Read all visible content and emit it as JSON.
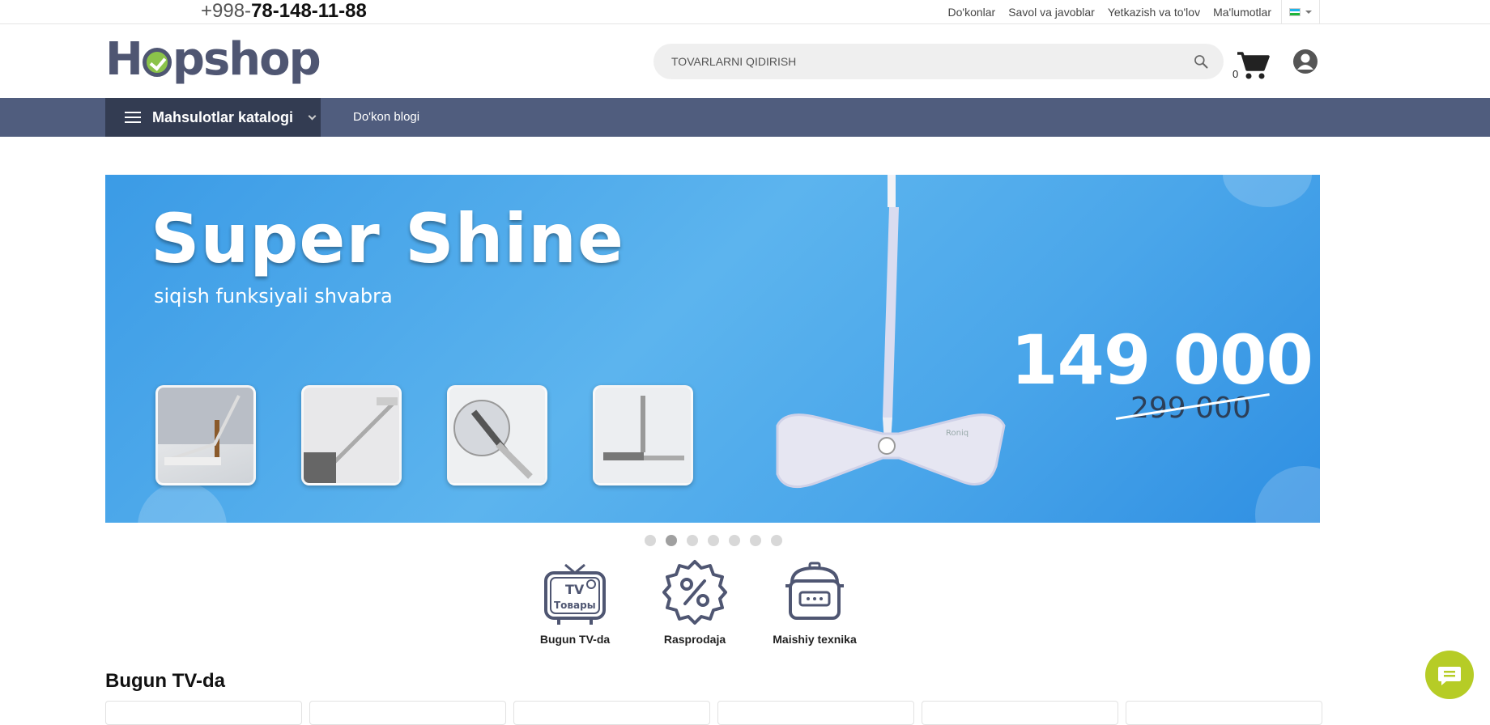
{
  "topbar": {
    "phone_prefix": "+998-",
    "phone_number": "78-148-11-88",
    "links": [
      "Do'konlar",
      "Savol va javoblar",
      "Yetkazish va to'lov",
      "Ma'lumotlar"
    ],
    "language_flag": "uz-flag"
  },
  "header": {
    "logo_text": "Hopshop",
    "search_placeholder": "TOVARLARNI QIDIRISH",
    "cart_count": "0"
  },
  "nav": {
    "catalog_label": "Mahsulotlar katalogi",
    "blog_label": "Do'kon blogi"
  },
  "banner": {
    "title": "Super Shine",
    "subtitle": "siqish funksiyali shvabra",
    "price": "149 000",
    "old_price": "299 000",
    "product_brand": "Roniq",
    "slide_count": 7,
    "active_slide": 2
  },
  "categories": [
    {
      "label": "Bugun TV-da",
      "icon": "tv-icon",
      "icon_text_1": "TV",
      "icon_text_2": "Товары"
    },
    {
      "label": "Rasprodaja",
      "icon": "percent-badge-icon"
    },
    {
      "label": "Maishiy texnika",
      "icon": "rice-cooker-icon"
    }
  ],
  "section": {
    "title": "Bugun TV-da"
  },
  "colors": {
    "nav_bg": "#505d7e",
    "catalog_bg": "#333c52",
    "brand_green": "#8bc34a",
    "banner_blue": "#4aa6ea",
    "chat_green": "#b6cc26"
  }
}
